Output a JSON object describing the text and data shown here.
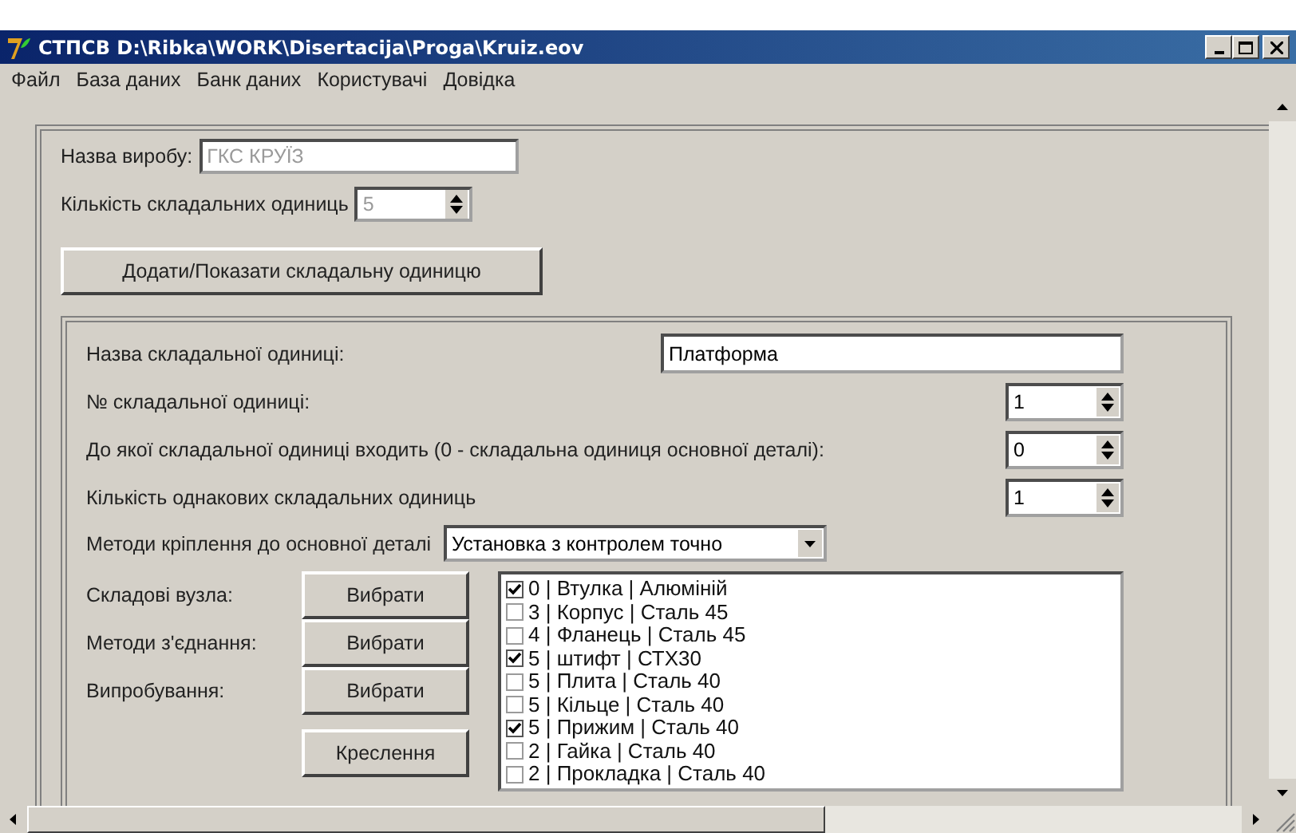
{
  "window": {
    "title": "СТПСВ D:\\Ribka\\WORK\\Disertacija\\Proga\\Kruiz.eov"
  },
  "menu": [
    "Файл",
    "База даних",
    "Банк даних",
    "Користувачі",
    "Довідка"
  ],
  "product": {
    "name_label": "Назва виробу:",
    "name_value": "ГКС КРУЇЗ",
    "name_disabled": true,
    "count_label": "Кількість складальних одиниць",
    "count_value": "5",
    "count_disabled": true,
    "add_button": "Додати/Показати складальну одиницю"
  },
  "unit": {
    "fields": [
      {
        "kind": "text",
        "label": "Назва складальної одиниці:",
        "value": "Платформа"
      },
      {
        "kind": "spin",
        "label": "№ складальної одиниці:",
        "value": "1"
      },
      {
        "kind": "spin",
        "label": "До якої складальної одиниці входить (0 - складальна одиниця основної деталі):",
        "value": "0"
      },
      {
        "kind": "spin",
        "label": "Кількість однакових складальних одиниць",
        "value": "1"
      }
    ],
    "method_label": "Методи кріплення до основної деталі",
    "method_value": "Установка з контролем точно",
    "choosers": [
      {
        "label": "Складові вузла:",
        "button": "Вибрати"
      },
      {
        "label": "Методи з'єднання:",
        "button": "Вибрати"
      },
      {
        "label": "Випробування:",
        "button": "Вибрати"
      }
    ],
    "drawing_button": "Креслення",
    "items": [
      {
        "text": "0 | Втулка | Алюміній",
        "checked": true
      },
      {
        "text": "3 | Корпус | Сталь 45",
        "checked": false
      },
      {
        "text": "4 | Фланець | Сталь 45",
        "checked": false
      },
      {
        "text": "5 | штифт | СТХ30",
        "checked": true
      },
      {
        "text": "5 | Плита | Сталь 40",
        "checked": false
      },
      {
        "text": "5 | Кільце | Сталь 40",
        "checked": false
      },
      {
        "text": "5 | Прижим | Сталь 40",
        "checked": true
      },
      {
        "text": "2 | Гайка | Сталь 40",
        "checked": false
      },
      {
        "text": "2 | Прокладка | Сталь 40",
        "checked": false
      }
    ]
  }
}
